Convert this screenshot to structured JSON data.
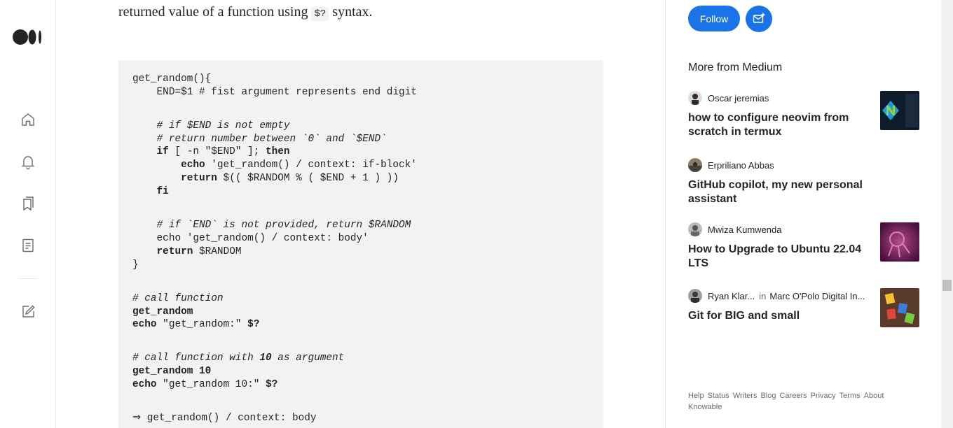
{
  "article": {
    "intro_before": "returned value of a function using ",
    "intro_code": "$?",
    "intro_after": " syntax."
  },
  "code": {
    "l1": "get_random(){",
    "l2": "    END=$1 # fist argument represents end digit",
    "l3": "    # if $END is not empty",
    "l4": "    # return number between `0` and `$END`",
    "l5_kw1": "if",
    "l5_mid": " [ -n \"$END\" ]; ",
    "l5_kw2": "then",
    "l6_kw": "echo",
    "l6_rest": " 'get_random() / context: if-block'",
    "l7_kw": "return",
    "l7_rest": " $(( $RANDOM % ( $END + 1 ) ))",
    "l8": "fi",
    "l9": "    # if `END` is not provided, return $RANDOM",
    "l10": "    echo 'get_random() / context: body'",
    "l11_kw": "return",
    "l11_rest": " $RANDOM",
    "l12": "}",
    "l13": "# call function",
    "l14": "get_random",
    "l15_kw": "echo",
    "l15_str": " \"get_random:\" ",
    "l15_var": "$?",
    "l16_cm": "# call function with ",
    "l16_num": "10",
    "l16_cm2": " as argument",
    "l17": "get_random 10",
    "l18_kw": "echo",
    "l18_str": " \"get_random 10:\" ",
    "l18_var": "$?",
    "l19": "⇒ get_random() / context: body"
  },
  "sidebar_right": {
    "follow_label": "Follow",
    "more_heading": "More from Medium",
    "stories": [
      {
        "author": "Oscar jeremias",
        "title": "how to configure neovim from scratch in termux",
        "publication": ""
      },
      {
        "author": "Erpriliano Abbas",
        "title": "GitHub copilot, my new personal assistant",
        "publication": ""
      },
      {
        "author": "Mwiza Kumwenda",
        "title": "How to Upgrade to Ubuntu 22.04 LTS",
        "publication": ""
      },
      {
        "author": "Ryan Klar...",
        "in": "in",
        "publication": "Marc O'Polo Digital In...",
        "title": "Git for BIG and small"
      }
    ],
    "footer": [
      "Help",
      "Status",
      "Writers",
      "Blog",
      "Careers",
      "Privacy",
      "Terms",
      "About",
      "Knowable"
    ]
  },
  "colors": {
    "accent": "#1a73e8",
    "code_bg": "#f2f2f2",
    "text": "#242424",
    "muted": "#6b6b6b"
  },
  "icons": [
    "medium-logo",
    "home-icon",
    "bell-icon",
    "bookmarks-icon",
    "stories-icon",
    "write-icon",
    "subscribe-mail-icon"
  ]
}
